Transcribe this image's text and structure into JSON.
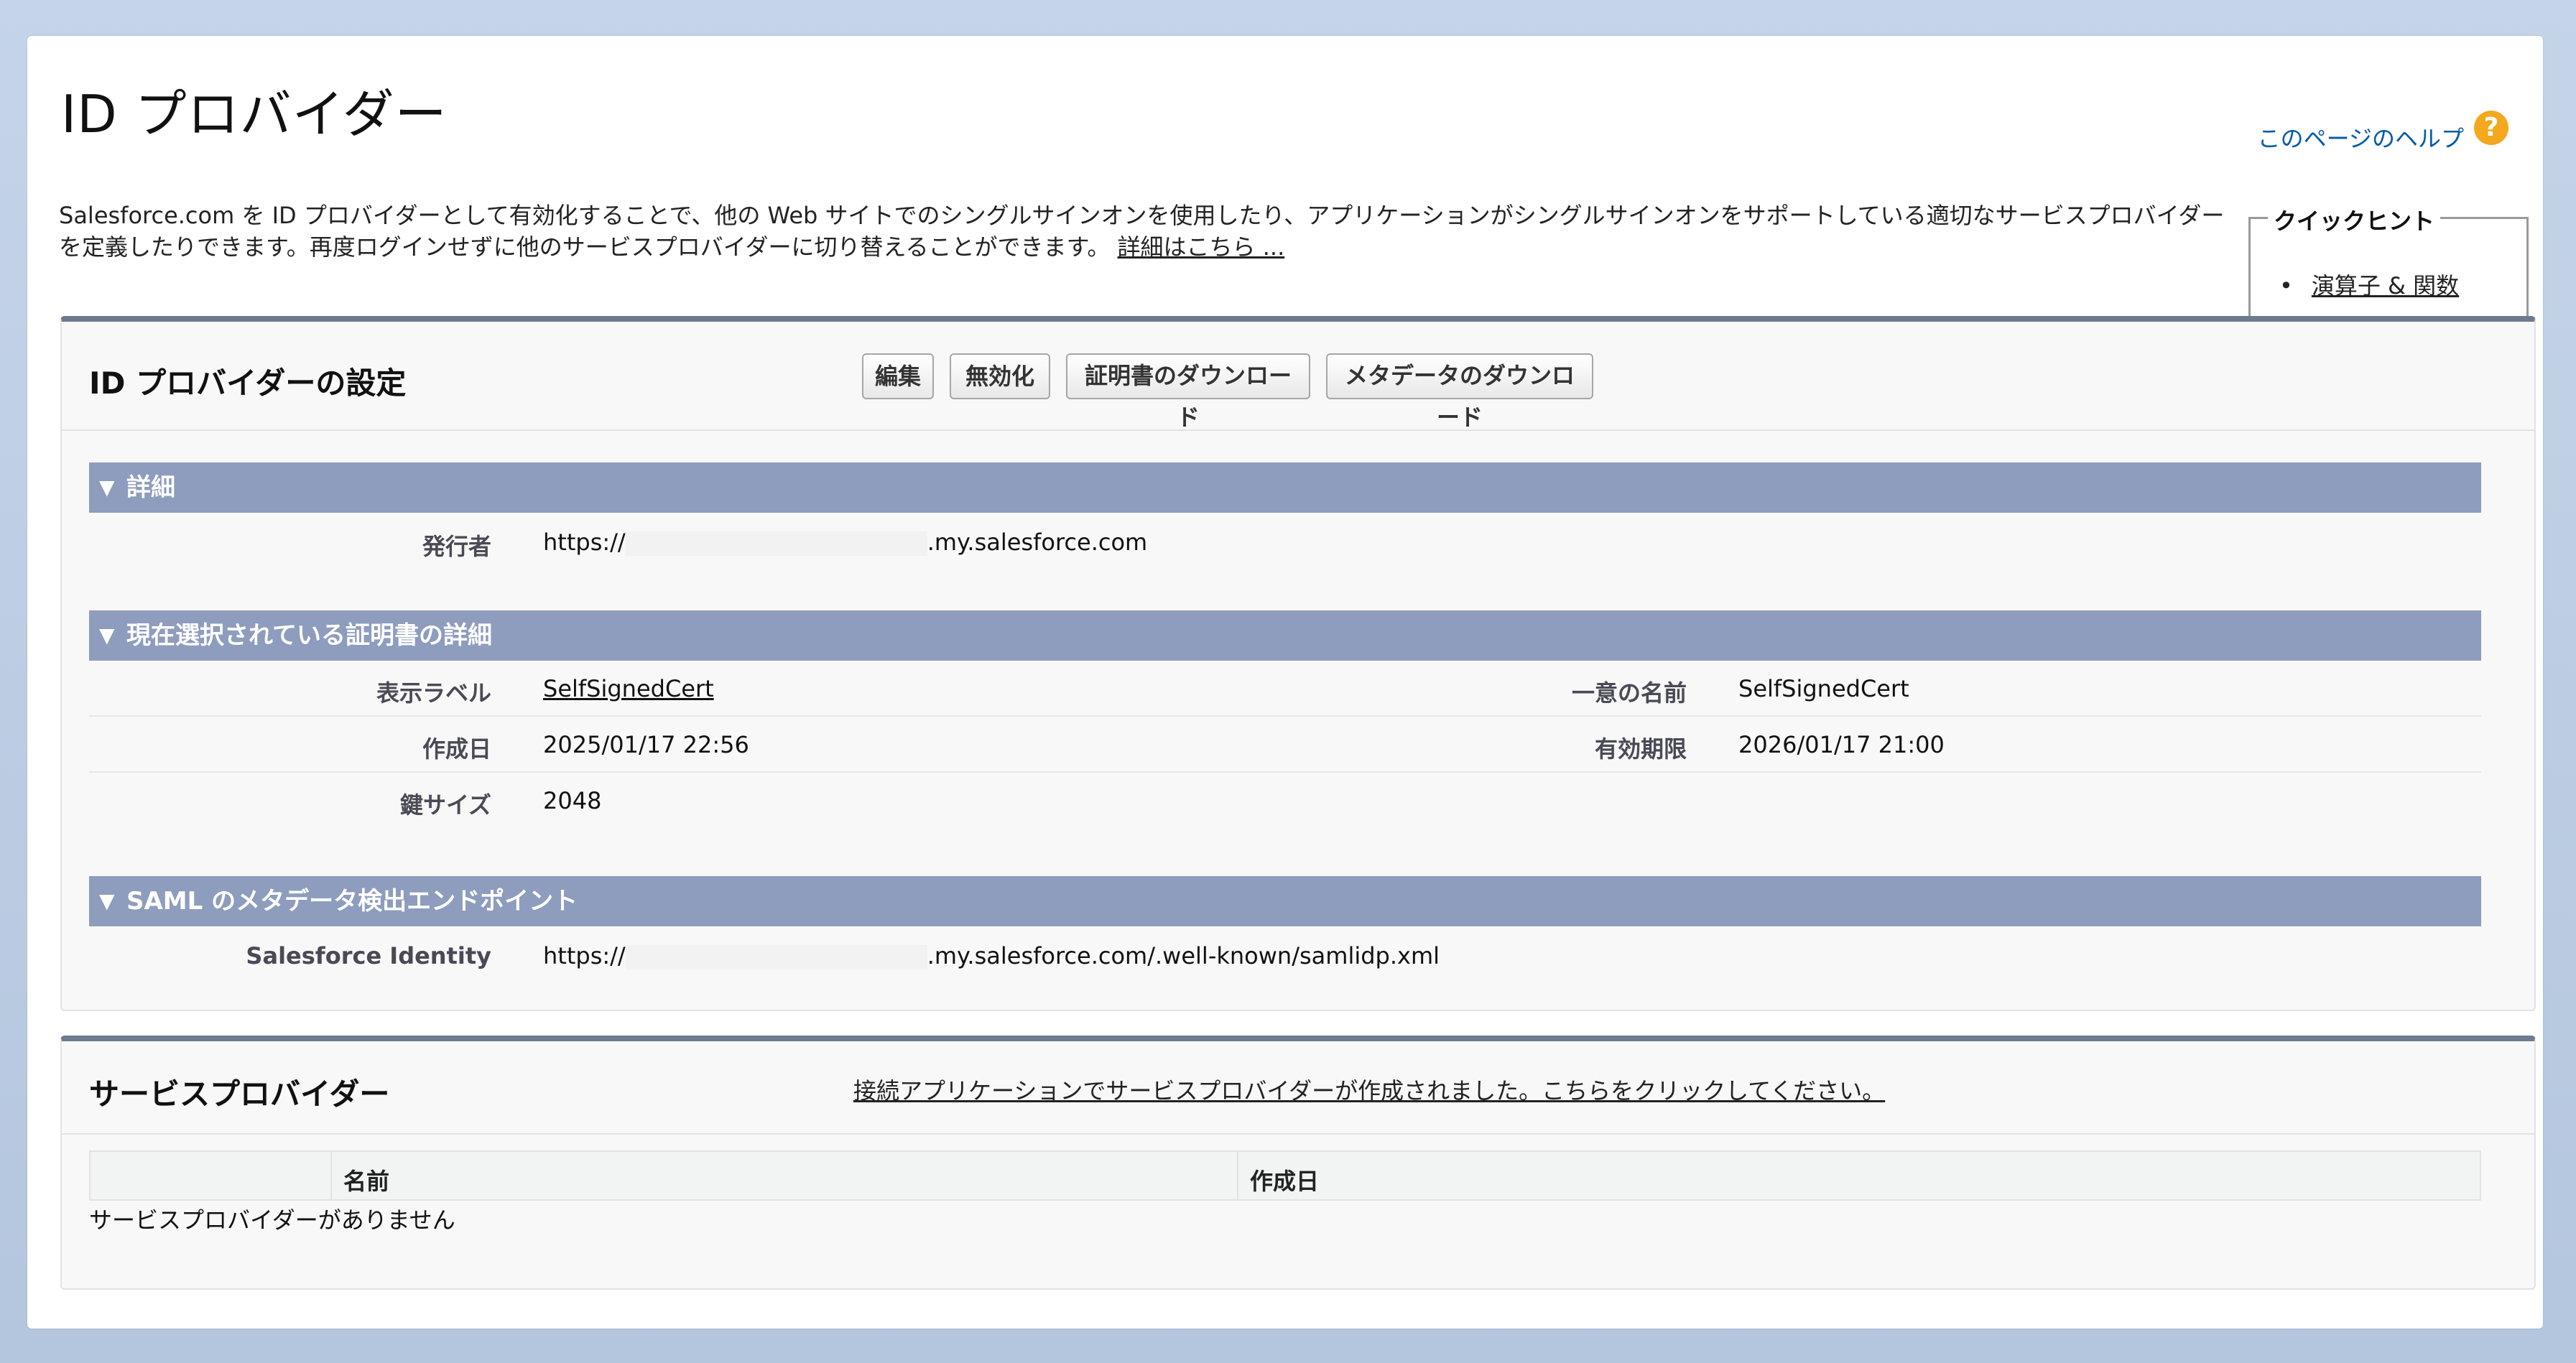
{
  "page": {
    "title": "ID プロバイダー",
    "help_link": "このページのヘルプ",
    "intro_text": "Salesforce.com を ID プロバイダーとして有効化することで、他の Web サイトでのシングルサインオンを使用したり、アプリケーションがシングルサインオンをサポートしている適切なサービスプロバイダーを定義したりできます。再度ログインせずに他のサービスプロバイダーに切り替えることができます。",
    "intro_link": "詳細はこちら ..."
  },
  "quick_tips": {
    "title": "クイックヒント",
    "items": [
      "演算子 & 関数"
    ]
  },
  "idp_settings": {
    "title": "ID プロバイダーの設定",
    "buttons": {
      "edit": "編集",
      "disable": "無効化",
      "download_cert": "証明書のダウンロード",
      "download_metadata": "メタデータのダウンロード"
    },
    "details_section": {
      "title": "詳細",
      "issuer_label": "発行者",
      "issuer_prefix": "https://",
      "issuer_suffix": ".my.salesforce.com"
    },
    "cert_section": {
      "title": "現在選択されている証明書の詳細",
      "display_label_label": "表示ラベル",
      "display_label_value": "SelfSignedCert",
      "unique_name_label": "一意の名前",
      "unique_name_value": "SelfSignedCert",
      "created_label": "作成日",
      "created_value": "2025/01/17 22:56",
      "expires_label": "有効期限",
      "expires_value": "2026/01/17 21:00",
      "key_size_label": "鍵サイズ",
      "key_size_value": "2048"
    },
    "saml_section": {
      "title": "SAML のメタデータ検出エンドポイント",
      "identity_label": "Salesforce Identity",
      "identity_prefix": "https://",
      "identity_suffix": ".my.salesforce.com/.well-known/samlidp.xml"
    }
  },
  "service_providers": {
    "title": "サービスプロバイダー",
    "link": "接続アプリケーションでサービスプロバイダーが作成されました。こちらをクリックしてください。",
    "columns": [
      "名前",
      "作成日"
    ],
    "empty_message": "サービスプロバイダーがありません"
  }
}
